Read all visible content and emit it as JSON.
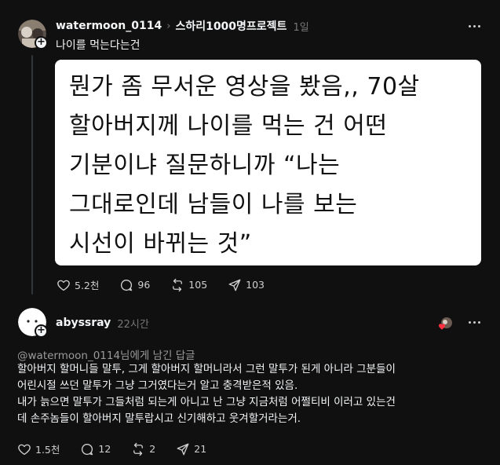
{
  "post": {
    "username": "watermoon_0114",
    "breadcrumb_sep": "›",
    "community": "스하리1000명프로젝트",
    "time": "1일",
    "text": "나이를 먹는다는건",
    "image_lines": [
      "뭔가 좀 무서운 영상을 봤음,, 70살",
      "할아버지께 나이를 먹는 건 어떤",
      "기분이냐 질문하니까 “나는",
      "그대로인데 남들이 나를 보는",
      "시선이 바뀌는 것”"
    ],
    "likes": "5.2천",
    "comments": "96",
    "reposts": "105",
    "shares": "103"
  },
  "reply": {
    "username": "abyssray",
    "time": "22시간",
    "context": "@watermoon_0114님에게 남긴 답글",
    "lines": [
      "할아버지 할머니들 말투, 그게 할아버지 할머니라서 그런 말투가 된게 아니라 그분들이",
      "어린시절 쓰던 말투가 그냥 그거였다는거 알고 충격받은적 있음.",
      "내가 늙으면 말투가 그들처럼 되는게 아니고 난 그냥 지금처럼 어쩔티비 이러고 있는건",
      "데 손주놈들이 할아버지 말투랍시고 신기해하고 웃겨할거라는거."
    ],
    "likes": "1.5천",
    "comments": "12",
    "reposts": "2",
    "shares": "21"
  },
  "colors": {
    "background": "#101010",
    "text": "#f3f5f7",
    "muted": "#777777",
    "heart": "#ff3040"
  },
  "icons": [
    "heart-icon",
    "comment-icon",
    "repost-icon",
    "share-icon",
    "more-icon",
    "follow-plus-icon"
  ]
}
